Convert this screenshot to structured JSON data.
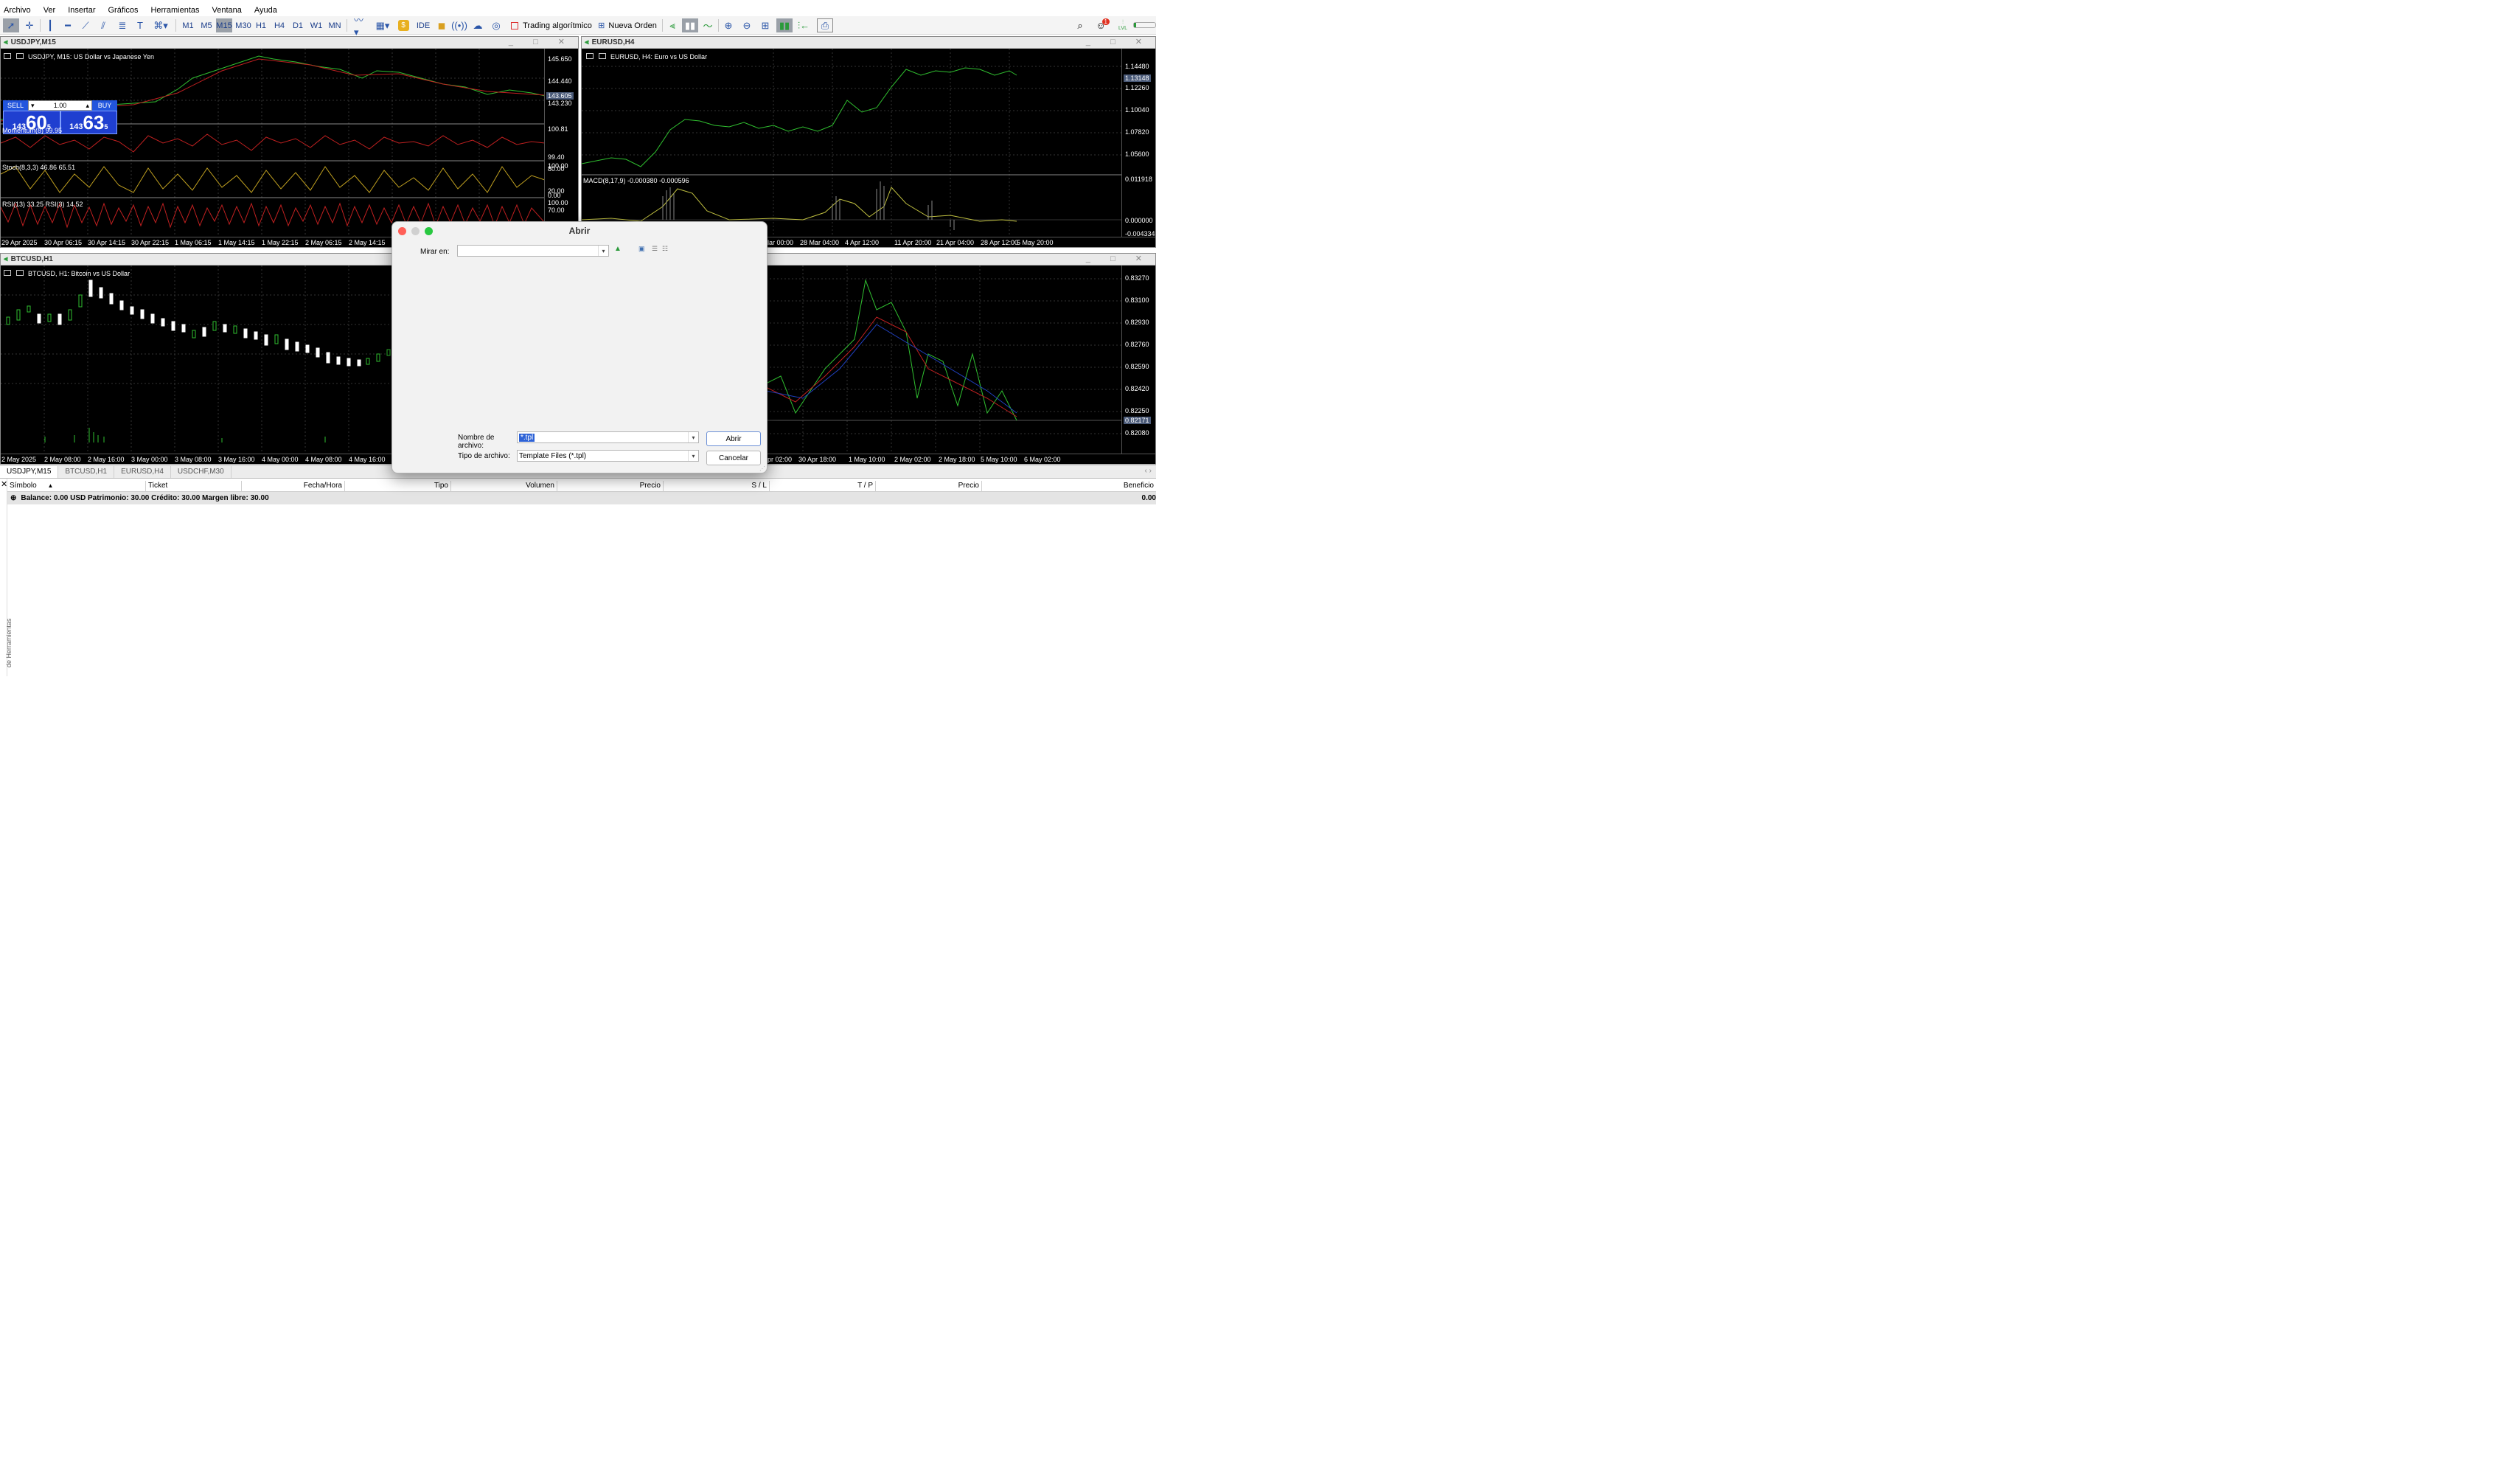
{
  "menu": [
    "Archivo",
    "Ver",
    "Insertar",
    "Gráficos",
    "Herramientas",
    "Ventana",
    "Ayuda"
  ],
  "toolbar": {
    "timeframes": [
      "M1",
      "M5",
      "M15",
      "M30",
      "H1",
      "H4",
      "D1",
      "W1",
      "MN"
    ],
    "active_timeframe": "M15",
    "ide": "IDE",
    "algo": "Trading algorítmico",
    "new_order": "Nueva Orden",
    "notif_count": "1",
    "lvl": "LVL"
  },
  "usdjpy": {
    "window_title": "USDJPY,M15",
    "chart_label": "USDJPY, M15:  US Dollar vs Japanese Yen",
    "sell": "SELL",
    "buy": "BUY",
    "lot": "1.00",
    "sell_big": "143",
    "sell_main": "60",
    "sell_sup": "5",
    "buy_big": "143",
    "buy_main": "63",
    "buy_sup": "5",
    "prices": [
      "145.650",
      "144.440",
      "143.605",
      "143.230"
    ],
    "momentum_label": "Momentum(8) 99.95",
    "momentum_scale": [
      "100.81",
      "99.40"
    ],
    "stoch_label": "Stoch(8,3,3) 46.86 65.51",
    "stoch_scale": [
      "100.00",
      "80.00",
      "20.00",
      "0.00"
    ],
    "rsi_label": "RSI(13) 33.25 RSI(3) 14.52",
    "rsi_scale": [
      "100.00",
      "70.00"
    ],
    "time_labels": [
      "29 Apr 2025",
      "30 Apr 06:15",
      "30 Apr 14:15",
      "30 Apr 22:15",
      "1 May 06:15",
      "1 May 14:15",
      "1 May 22:15",
      "2 May 06:15",
      "2 May 14:15"
    ]
  },
  "eurusd": {
    "window_title": "EURUSD,H4",
    "chart_label": "EURUSD, H4:  Euro vs US Dollar",
    "prices": [
      "1.14480",
      "1.13148",
      "1.12260",
      "1.10040",
      "1.07820",
      "1.05600"
    ],
    "macd_label": "MACD(8,17,9) -0.000380 -0.000596",
    "macd_scale": [
      "0.011918",
      "0.000000",
      "-0.004334"
    ],
    "time_labels": [
      "lar 00:00",
      "28 Mar 04:00",
      "4 Apr 12:00",
      "11 Apr 20:00",
      "21 Apr 04:00",
      "28 Apr 12:00",
      "5 May 20:00"
    ]
  },
  "btcusd": {
    "window_title": "BTCUSD,H1",
    "chart_label": "BTCUSD, H1:  Bitcoin vs US Dollar",
    "time_labels": [
      "2 May 2025",
      "2 May 08:00",
      "2 May 16:00",
      "3 May 00:00",
      "3 May 08:00",
      "3 May 16:00",
      "4 May 00:00",
      "4 May 08:00",
      "4 May 16:00"
    ]
  },
  "usdchf": {
    "prices": [
      "0.83270",
      "0.83100",
      "0.82930",
      "0.82760",
      "0.82590",
      "0.82420",
      "0.82250",
      "0.82171",
      "0.82080"
    ],
    "time_labels": [
      "pr 02:00",
      "30 Apr 18:00",
      "1 May 10:00",
      "2 May 02:00",
      "2 May 18:00",
      "5 May 10:00",
      "6 May 02:00"
    ]
  },
  "tabs": [
    "USDJPY,M15",
    "BTCUSD,H1",
    "EURUSD,H4",
    "USDCHF,M30"
  ],
  "terminal": {
    "columns": [
      "Símbolo",
      "Ticket",
      "Fecha/Hora",
      "Tipo",
      "Volumen",
      "Precio",
      "S / L",
      "T / P",
      "Precio",
      "Beneficio"
    ],
    "balance": "Balance: 0.00 USD  Patrimonio: 30.00  Crédito: 30.00  Margen libre: 30.00",
    "profit": "0.00",
    "side_label": "de Herramientas"
  },
  "dialog": {
    "title": "Abrir",
    "look_in_label": "Mirar en:",
    "look_in_value": "",
    "filename_label": "Nombre de archivo:",
    "filename_value": "*.tpl",
    "filetype_label": "Tipo de archivo:",
    "filetype_value": "Template Files (*.tpl)",
    "open_button": "Abrir",
    "cancel_button": "Cancelar"
  }
}
